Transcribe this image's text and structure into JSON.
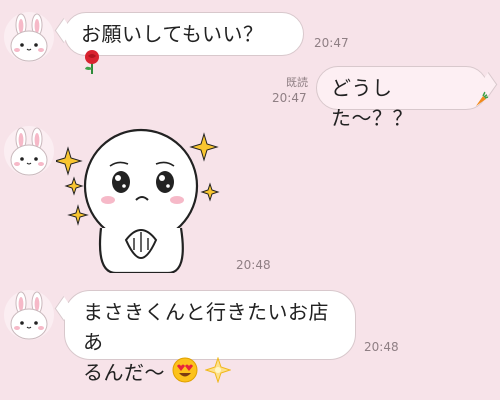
{
  "messages": [
    {
      "id": "m1",
      "side": "incoming",
      "text": "お願いしてもいい？",
      "emoji": "rose-emoji",
      "time": "20:47"
    },
    {
      "id": "m2",
      "side": "outgoing",
      "read_label": "既読",
      "text": "どうした〜？？",
      "emoji": "carrot-emoji",
      "time": "20:47"
    },
    {
      "id": "m3",
      "side": "incoming",
      "type": "sticker",
      "sticker": "moon-pleading-sticker",
      "time": "20:48"
    },
    {
      "id": "m4",
      "side": "incoming",
      "line1": "まさきくんと行きたいお店あ",
      "line2": "るんだ〜",
      "emojis": [
        "heart-eyes-emoji",
        "sparkle-star-emoji"
      ],
      "time": "20:48"
    }
  ],
  "colors": {
    "background": "#f7e3e9",
    "bubble_incoming": "#ffffff",
    "bubble_outgoing": "#fdeff3",
    "bubble_border": "#d8c8cc",
    "meta_text": "#8f7f84"
  }
}
